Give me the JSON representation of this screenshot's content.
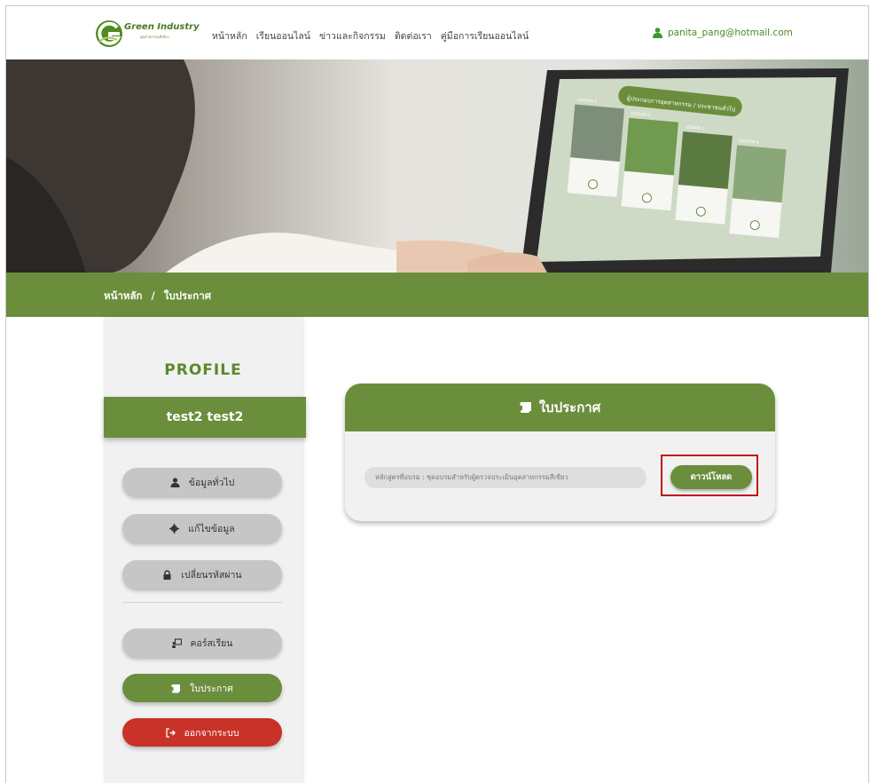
{
  "navbar": {
    "logo_text": "Green Industry",
    "logo_sub": "อุตสาหกรรมสีเขียว",
    "menu": [
      "หน้าหลัก",
      "เรียนออนไลน์",
      "ข่าวและกิจกรรม",
      "ติดต่อเรา",
      "คู่มือการเรียนออนไลน์"
    ],
    "user_email": "panita_pang@hotmail.com"
  },
  "hero": {
    "screen_title": "ผู้ประกอบการอุตสาหกรรม / ประชาชนทั่วไป",
    "lessons": [
      "LESSON 1",
      "LESSON 2",
      "LESSON 3",
      "LESSON 4"
    ]
  },
  "breadcrumb": {
    "home": "หน้าหลัก",
    "separator": "/",
    "current": "ใบประกาศ"
  },
  "sidebar": {
    "title": "PROFILE",
    "user_name": "test2  test2",
    "buttons": {
      "general": "ข้อมูลทั่วไป",
      "edit": "แก้ไขข้อมูล",
      "password": "เปลี่ยนรหัสผ่าน",
      "courses": "คอร์สเรียน",
      "certificate": "ใบประกาศ",
      "logout": "ออกจากระบบ"
    }
  },
  "certificate": {
    "heading": "ใบประกาศ",
    "course_label": "หลักสูตรที่อบรม : ชุดอบรมสำหรับผู้ตรวจประเมินอุตสาหกรรมสีเขียว",
    "download": "ดาวน์โหลด"
  },
  "colors": {
    "brand_green": "#6b8e3d",
    "logout_red": "#c83228",
    "highlight_red": "#c01414"
  }
}
